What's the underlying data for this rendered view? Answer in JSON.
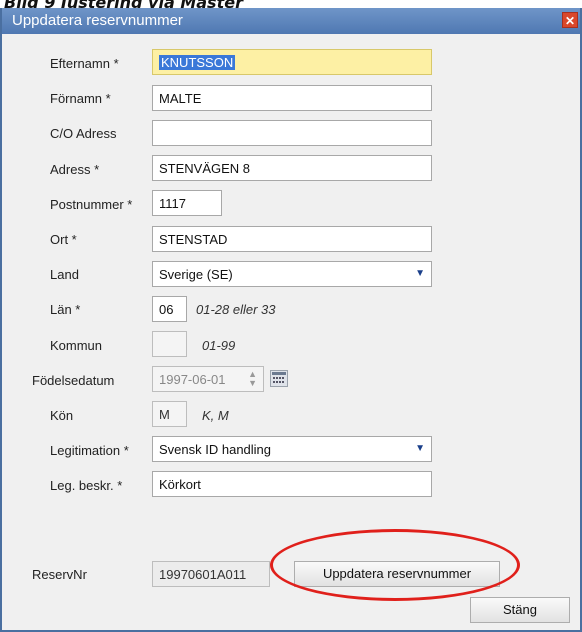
{
  "caption": "Bild 9 Justering via Master",
  "window": {
    "title": "Uppdatera reservnummer",
    "close_glyph": "✕"
  },
  "form": {
    "efternamn": {
      "label": "Efternamn *",
      "value": "KNUTSSON"
    },
    "fornamn": {
      "label": "Förnamn *",
      "value": "MALTE"
    },
    "co_adress": {
      "label": "C/O Adress",
      "value": ""
    },
    "adress": {
      "label": "Adress *",
      "value": "STENVÄGEN 8"
    },
    "postnummer": {
      "label": "Postnummer *",
      "value": "1117"
    },
    "ort": {
      "label": "Ort *",
      "value": "STENSTAD"
    },
    "land": {
      "label": "Land",
      "value": "Sverige (SE)"
    },
    "lan": {
      "label": "Län *",
      "value": "06",
      "hint": "01-28 eller 33"
    },
    "kommun": {
      "label": "Kommun",
      "value": "",
      "hint": "01-99"
    },
    "fodelsedatum": {
      "label": "Födelsedatum",
      "value": "1997-06-01"
    },
    "kon": {
      "label": "Kön",
      "value": "M",
      "hint": "K, M"
    },
    "legitimation": {
      "label": "Legitimation *",
      "value": "Svensk ID handling"
    },
    "leg_beskr": {
      "label": "Leg. beskr. *",
      "value": "Körkort"
    },
    "reservnr": {
      "label": "ReservNr",
      "value": "19970601A011"
    }
  },
  "buttons": {
    "update": "Uppdatera reservnummer",
    "close": "Stäng"
  },
  "icons": {
    "dropdown": "chevron-down-icon",
    "calendar": "calendar-icon",
    "spinner": "spinner-icon"
  },
  "colors": {
    "titlebar": "#5b84bd",
    "highlight_field": "#fdf0a4",
    "annotation": "#e0201b"
  }
}
